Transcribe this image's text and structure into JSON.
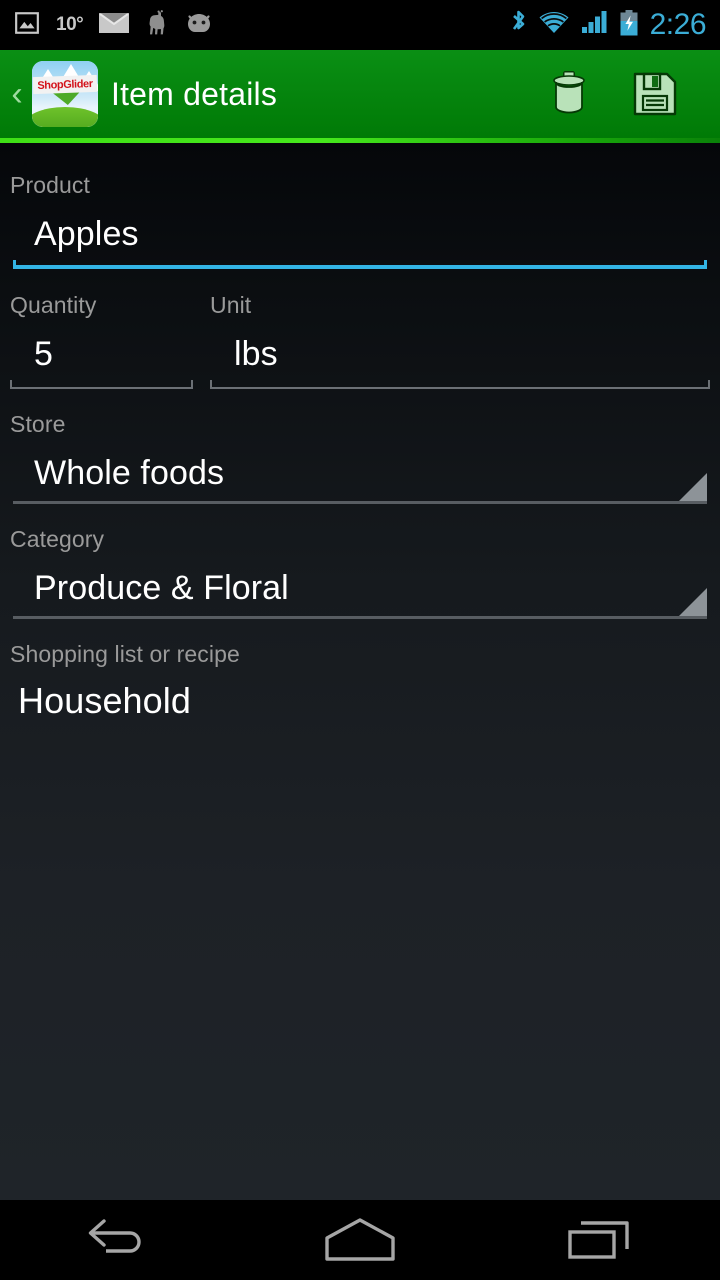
{
  "status_bar": {
    "time": "2:26",
    "temperature": "10°",
    "icons": [
      {
        "name": "photo-icon",
        "label": "photo"
      },
      {
        "name": "mail-icon",
        "label": "mail"
      },
      {
        "name": "llama-icon",
        "label": "llama"
      },
      {
        "name": "android-head-icon",
        "label": "android"
      },
      {
        "name": "bluetooth-icon",
        "label": "bluetooth"
      },
      {
        "name": "wifi-icon",
        "label": "wifi"
      },
      {
        "name": "cellular-signal-icon",
        "label": "signal"
      },
      {
        "name": "battery-charging-icon",
        "label": "battery charging"
      }
    ],
    "accent_color": "#3badd6",
    "icon_color": "#c8c8c8",
    "background": "#000000"
  },
  "action_bar": {
    "title": "Item details",
    "back_label": "‹",
    "app_logo_text": "ShopGlider",
    "delete_label": "Delete",
    "save_label": "Save",
    "background_color": "#008006",
    "accent_underline_color": "#3fe016"
  },
  "form": {
    "product": {
      "label": "Product",
      "value": "Apples",
      "placeholder": "Product",
      "focused": true,
      "underline_color": "#33b5e5"
    },
    "quantity": {
      "label": "Quantity",
      "value": "5",
      "placeholder": "Quantity",
      "focused": false,
      "underline_color": "#6b7075"
    },
    "unit": {
      "label": "Unit",
      "value": "lbs",
      "placeholder": "Unit",
      "focused": false,
      "underline_color": "#6b7075"
    },
    "store": {
      "label": "Store",
      "value": "Whole foods",
      "type": "spinner"
    },
    "category": {
      "label": "Category",
      "value": "Produce & Floral",
      "type": "spinner"
    },
    "shopping_list": {
      "label": "Shopping list or recipe",
      "value": "Household",
      "type": "text"
    },
    "label_color": "#9a9a9a",
    "value_color": "#ffffff",
    "background_color": "#1f2429"
  },
  "nav_bar": {
    "back_label": "Back",
    "home_label": "Home",
    "recents_label": "Recent apps",
    "icon_color": "#a6a6a6",
    "background": "#000000"
  }
}
